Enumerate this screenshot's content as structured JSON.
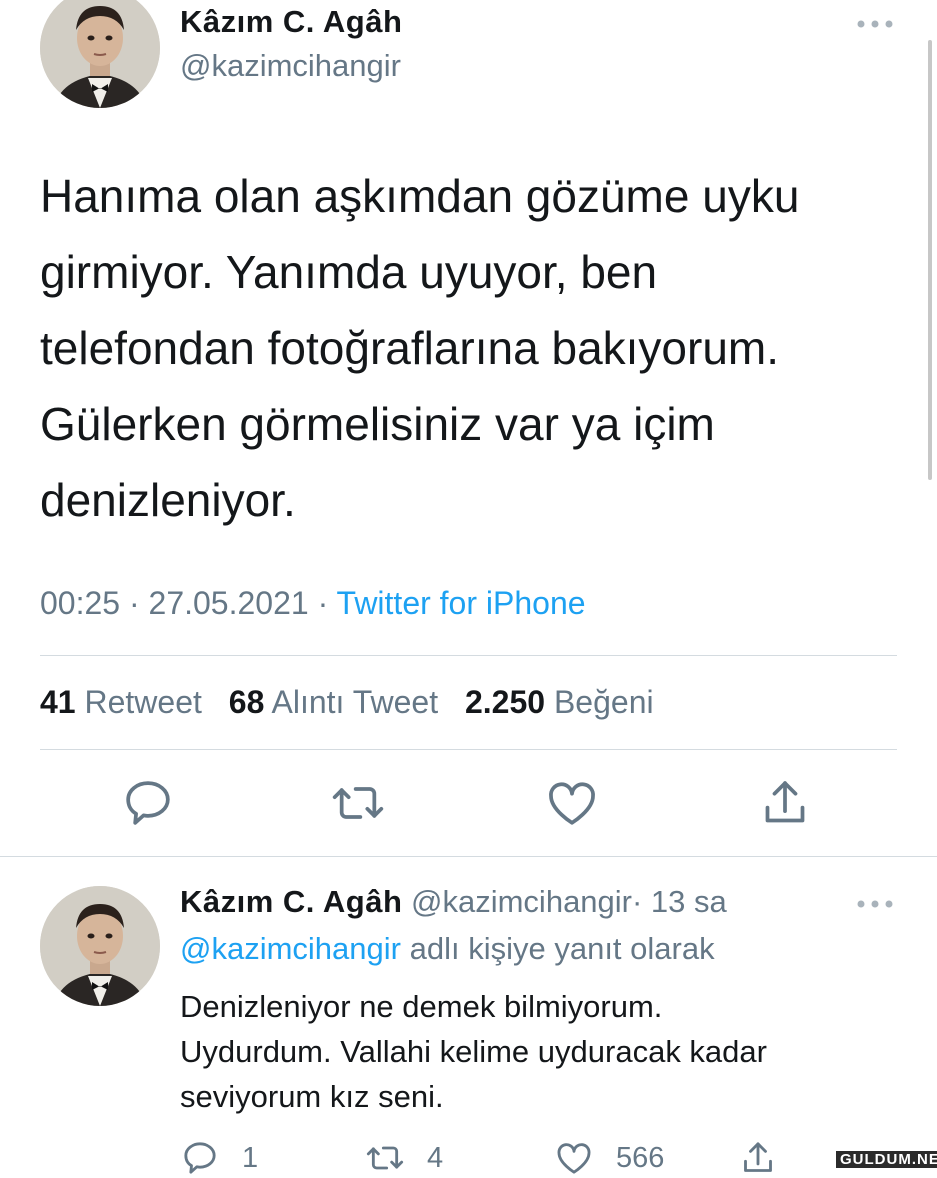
{
  "main_tweet": {
    "author_name": "Kâzım C. Agâh",
    "author_handle": "@kazimcihangir",
    "text_lines": [
      "Hanıma olan aşkımdan gözüme uyku",
      "girmiyor. Yanımda uyuyor, ben",
      "telefondan fotoğraflarına bakıyorum.",
      "Gülerken görmelisiniz var ya içim",
      "denizleniyor."
    ],
    "time": "00:25",
    "date": "27.05.2021",
    "separator": "·",
    "source": "Twitter for iPhone",
    "stats": {
      "retweets_count": "41",
      "retweets_label": "Retweet",
      "quotes_count": "68",
      "quotes_label": "Alıntı Tweet",
      "likes_count": "2.250",
      "likes_label": "Beğeni"
    }
  },
  "reply_tweet": {
    "author_name": "Kâzım C. Agâh",
    "author_handle": "@kazimcihangir",
    "time_ago": "· 13 sa",
    "replying_to_mention": "@kazimcihangir",
    "replying_to_text": "adlı kişiye yanıt olarak",
    "text_lines": [
      "Denizleniyor ne demek bilmiyorum.",
      "Uydurdum. Vallahi kelime uyduracak kadar",
      "seviyorum kız seni."
    ],
    "reply_count": "1",
    "retweet_count": "4",
    "like_count": "566"
  },
  "watermark": "GULDUM.NET",
  "colors": {
    "text": "#14171a",
    "secondary": "#657786",
    "accent": "#1da1f2",
    "divider": "#d4dbe0"
  },
  "icons": {
    "more": "more-horizontal-icon",
    "reply": "reply-icon",
    "retweet": "retweet-icon",
    "like": "heart-icon",
    "share": "share-icon"
  }
}
